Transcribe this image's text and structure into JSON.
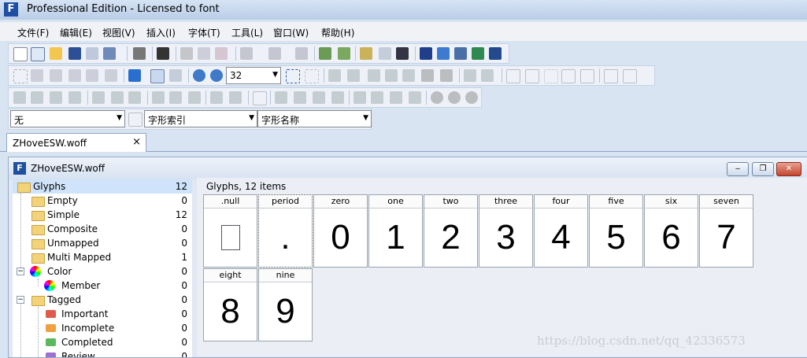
{
  "window": {
    "title": "Professional Edition - Licensed to font",
    "icon": "app-logo-icon"
  },
  "menu": [
    "文件(F)",
    "编辑(E)",
    "视图(V)",
    "插入(I)",
    "字体(T)",
    "工具(L)",
    "窗口(W)",
    "帮助(H)"
  ],
  "toolbar": {
    "zoom_value": "32"
  },
  "filters": {
    "combo1": "无",
    "combo2": "字形索引",
    "combo3": "字形名称"
  },
  "tab": {
    "label": "ZHoveESW.woff",
    "close": "×"
  },
  "document": {
    "title": "ZHoveESW.woff",
    "minimize": "‒",
    "restore": "❐",
    "close": "✕"
  },
  "tree": [
    {
      "label": "Glyphs",
      "count": "12"
    },
    {
      "label": "Empty",
      "count": "0"
    },
    {
      "label": "Simple",
      "count": "12"
    },
    {
      "label": "Composite",
      "count": "0"
    },
    {
      "label": "Unmapped",
      "count": "0"
    },
    {
      "label": "Multi Mapped",
      "count": "1"
    },
    {
      "label": "Color",
      "count": "0"
    },
    {
      "label": "Member",
      "count": "0"
    },
    {
      "label": "Tagged",
      "count": "0"
    },
    {
      "label": "Important",
      "count": "0"
    },
    {
      "label": "Incomplete",
      "count": "0"
    },
    {
      "label": "Completed",
      "count": "0"
    },
    {
      "label": "Review",
      "count": "0"
    }
  ],
  "glyph_pane": {
    "header": "Glyphs, 12 items"
  },
  "glyphs": [
    {
      "name": ".null",
      "char": ""
    },
    {
      "name": "period",
      "char": "."
    },
    {
      "name": "zero",
      "char": "0"
    },
    {
      "name": "one",
      "char": "1"
    },
    {
      "name": "two",
      "char": "2"
    },
    {
      "name": "three",
      "char": "3"
    },
    {
      "name": "four",
      "char": "4"
    },
    {
      "name": "five",
      "char": "5"
    },
    {
      "name": "six",
      "char": "6"
    },
    {
      "name": "seven",
      "char": "7"
    },
    {
      "name": "eight",
      "char": "8"
    },
    {
      "name": "nine",
      "char": "9"
    }
  ],
  "watermark": "https://blog.csdn.net/qq_42336573",
  "colors": {
    "tag_important": "#e05a4a",
    "tag_incomplete": "#f0a040",
    "tag_completed": "#5cb85c",
    "tag_review": "#a070d0"
  }
}
